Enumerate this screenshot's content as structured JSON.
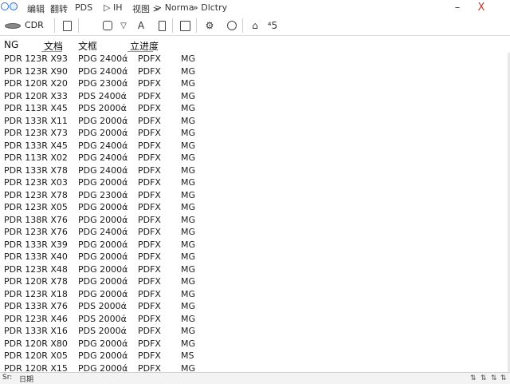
{
  "titlebar": {
    "menu": [
      "编辑",
      "翻转",
      "PDS",
      "▷ IH",
      "视图 >",
      "> Norma",
      "» Dlctry"
    ],
    "minimize": "–",
    "close": "X"
  },
  "toolbar": {
    "disk_label": "CDR",
    "buttons": [
      "A",
      "▽"
    ],
    "gear": "⚙",
    "clock": "⏱",
    "undo": "⌂",
    "num": "⁴5"
  },
  "table": {
    "headers": {
      "ng": "NG",
      "c1": "文档",
      "c2": "文框",
      "c3": "立进度"
    },
    "rows": [
      {
        "ng": "PDR 123R X93",
        "file": "PDG 2400ά",
        "ext": "PDFX",
        "type": "MG"
      },
      {
        "ng": "PDR 123R X90",
        "file": "PDG 2400ά",
        "ext": "PDFX",
        "type": "MG"
      },
      {
        "ng": "PDR 120R X20",
        "file": "PDG 2300ά",
        "ext": "PDFX",
        "type": "MG"
      },
      {
        "ng": "PDR 120R X33",
        "file": "PDS 2400ά",
        "ext": "PDFX",
        "type": "MG"
      },
      {
        "ng": "PDR 113R X45",
        "file": "PDS 2000ά",
        "ext": "PDFX",
        "type": "MG"
      },
      {
        "ng": "PDR 133R X11",
        "file": "PDG 2000ά",
        "ext": "PDFX",
        "type": "MG"
      },
      {
        "ng": "PDR 123R X73",
        "file": "PDG 2000ά",
        "ext": "PDFX",
        "type": "MG"
      },
      {
        "ng": "PDR 133R X45",
        "file": "PDG 2400ά",
        "ext": "PDFX",
        "type": "MG"
      },
      {
        "ng": "PDR 113R X02",
        "file": "PDG 2400ά",
        "ext": "PDFX",
        "type": "MG"
      },
      {
        "ng": "PDR 133R X78",
        "file": "PDG 2400ά",
        "ext": "PDFX",
        "type": "MG"
      },
      {
        "ng": "PDR 123R X03",
        "file": "PDG 2000ά",
        "ext": "PDFX",
        "type": "MG"
      },
      {
        "ng": "PDR 123R X78",
        "file": "PDG 2300ά",
        "ext": "PDFX",
        "type": "MG"
      },
      {
        "ng": "PDR 123R X05",
        "file": "PDG 2000ά",
        "ext": "PDFX",
        "type": "MG"
      },
      {
        "ng": "PDR 138R X76",
        "file": "PDG 2000ά",
        "ext": "PDFX",
        "type": "MG"
      },
      {
        "ng": "PDR 123R X76",
        "file": "PDG 2400ά",
        "ext": "PDFX",
        "type": "MG"
      },
      {
        "ng": "PDR 133R X39",
        "file": "PDG 2000ά",
        "ext": "PDFX",
        "type": "MG"
      },
      {
        "ng": "PDR 133R X40",
        "file": "PDG 2000ά",
        "ext": "PDFX",
        "type": "MG"
      },
      {
        "ng": "PDR 123R X48",
        "file": "PDG 2000ά",
        "ext": "PDFX",
        "type": "MG"
      },
      {
        "ng": "PDR 120R X78",
        "file": "PDG 2000ά",
        "ext": "PDFX",
        "type": "MG"
      },
      {
        "ng": "PDR 123R X18",
        "file": "PDG 2000ά",
        "ext": "PDFX",
        "type": "MG"
      },
      {
        "ng": "PDR 133R X76",
        "file": "PDS 2000ά",
        "ext": "PDFX",
        "type": "MG"
      },
      {
        "ng": "PDR 123R X46",
        "file": "PDS 2000ά",
        "ext": "PDFX",
        "type": "MG"
      },
      {
        "ng": "PDR 133R X16",
        "file": "PDS 2000ά",
        "ext": "PDFX",
        "type": "MG"
      },
      {
        "ng": "PDR 120R X80",
        "file": "PDG 2000ά",
        "ext": "PDFX",
        "type": "MG"
      },
      {
        "ng": "PDR 120R X05",
        "file": "PDG 2000ά",
        "ext": "PDFX",
        "type": "MS"
      },
      {
        "ng": "PDR 120R X15",
        "file": "PDG 2000ά",
        "ext": "PDFX",
        "type": "MG"
      }
    ]
  },
  "statusbar": {
    "left": "Sr:",
    "left2": "日期",
    "icons": [
      "⇅",
      "⇅",
      "⇅",
      "⇅"
    ]
  }
}
